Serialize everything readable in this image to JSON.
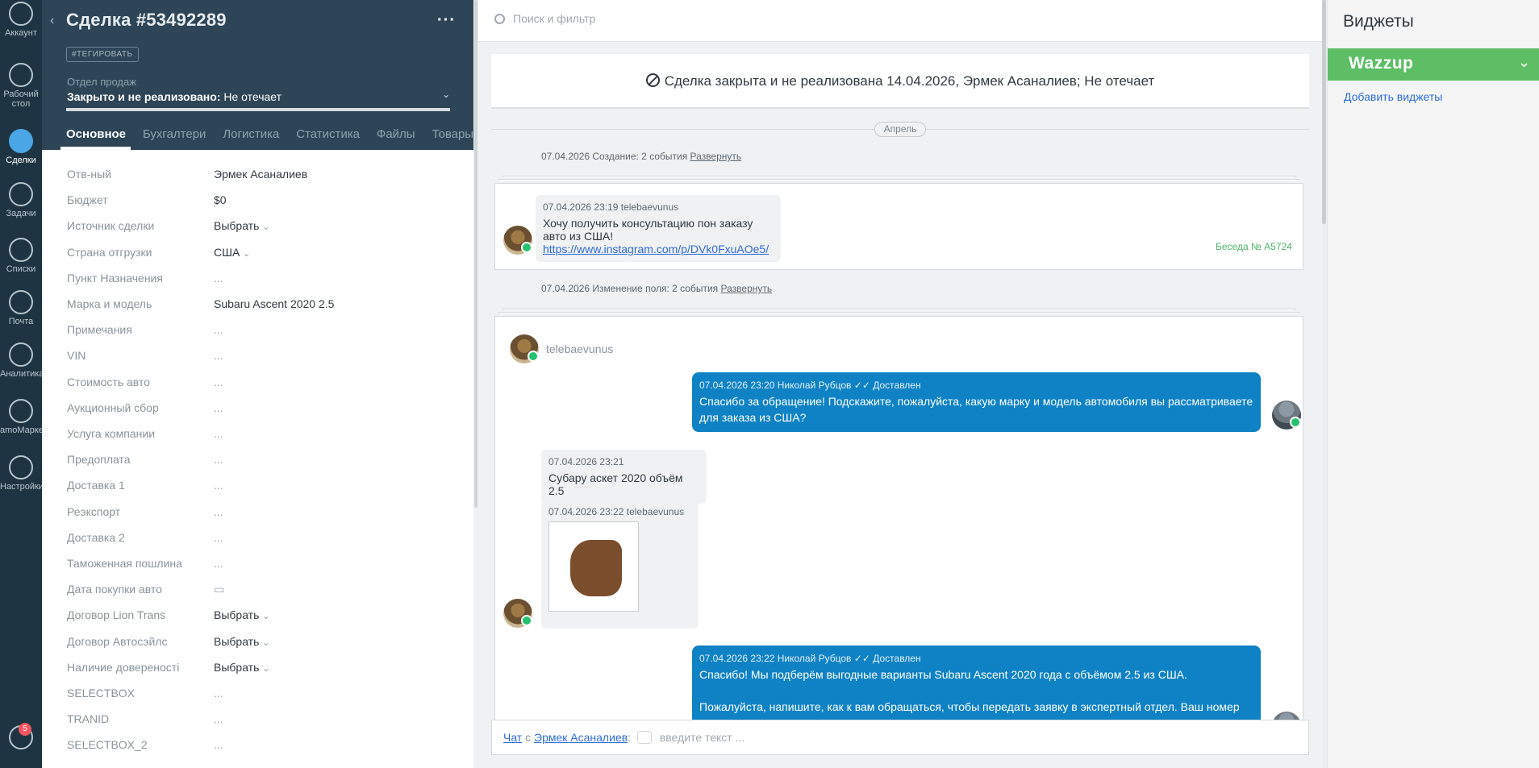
{
  "nav": {
    "items": [
      {
        "label": "Аккаунт",
        "active": false,
        "icon": "account-icon"
      },
      {
        "label": "Рабочий стол",
        "active": false,
        "icon": "dashboard-icon"
      },
      {
        "label": "Сделки",
        "active": true,
        "icon": "deals-icon"
      },
      {
        "label": "Задачи",
        "active": false,
        "icon": "tasks-icon"
      },
      {
        "label": "Списки",
        "active": false,
        "icon": "lists-icon"
      },
      {
        "label": "Почта",
        "active": false,
        "icon": "mail-icon"
      },
      {
        "label": "Аналитика",
        "active": false,
        "icon": "analytics-icon"
      },
      {
        "label": "amoМаркет",
        "active": false,
        "icon": "market-icon"
      },
      {
        "label": "Настройки",
        "active": false,
        "icon": "settings-icon"
      }
    ],
    "notifications_count": "5"
  },
  "card": {
    "title": "Сделка #53492289",
    "tag_button": "#ТЕГИРОВАТЬ",
    "pipeline_label": "Отдел продаж",
    "status_bold": "Закрыто и не реализовано:",
    "status_reason": "Не отечает",
    "tabs": [
      "Основное",
      "Бухгалтери",
      "Логистика",
      "Статистика",
      "Файлы",
      "Товары"
    ],
    "tab_more": "···",
    "fields": [
      {
        "name": "Отв-ный",
        "value": "Эрмек Асаналиев",
        "kind": "text"
      },
      {
        "name": "Бюджет",
        "value": "$0",
        "kind": "text"
      },
      {
        "name": "Источник сделки",
        "value": "Выбрать",
        "kind": "select"
      },
      {
        "name": "Страна отгрузки",
        "value": "США",
        "kind": "select"
      },
      {
        "name": "Пункт Назначения",
        "value": "...",
        "kind": "empty"
      },
      {
        "name": "Марка и модель",
        "value": "Subaru Ascent 2020 2.5",
        "kind": "text"
      },
      {
        "name": "Примечания",
        "value": "...",
        "kind": "empty"
      },
      {
        "name": "VIN",
        "value": "...",
        "kind": "empty"
      },
      {
        "name": "Стоимость авто",
        "value": "...",
        "kind": "empty"
      },
      {
        "name": "Аукционный сбор",
        "value": "...",
        "kind": "empty"
      },
      {
        "name": "Услуга компании",
        "value": "...",
        "kind": "empty"
      },
      {
        "name": "Предоплата",
        "value": "...",
        "kind": "empty"
      },
      {
        "name": "Доставка 1",
        "value": "...",
        "kind": "empty"
      },
      {
        "name": "Реэкспорт",
        "value": "...",
        "kind": "empty"
      },
      {
        "name": "Доставка 2",
        "value": "...",
        "kind": "empty"
      },
      {
        "name": "Таможенная пошлина",
        "value": "...",
        "kind": "empty"
      },
      {
        "name": "Дата покупки авто",
        "value": "▭",
        "kind": "empty"
      },
      {
        "name": "Договор Lion Trans",
        "value": "Выбрать",
        "kind": "select"
      },
      {
        "name": "Договор Автосэйлс",
        "value": "Выбрать",
        "kind": "select"
      },
      {
        "name": "Наличие довереностi",
        "value": "Выбрать",
        "kind": "select"
      },
      {
        "name": "SELECTBOX",
        "value": "...",
        "kind": "empty"
      },
      {
        "name": "TRANID",
        "value": "...",
        "kind": "empty"
      },
      {
        "name": "SELECTBOX_2",
        "value": "...",
        "kind": "empty"
      }
    ]
  },
  "feed": {
    "search_placeholder": "Поиск и фильтр",
    "closed_banner": "Сделка закрыта и не реализована 14.04.2026, Эрмек Асаналиев; Не отечает",
    "month_label": "Апрель",
    "group1": {
      "text": "07.04.2026 Создание: 2 события",
      "link": "Развернуть"
    },
    "msg1": {
      "meta": "07.04.2026 23:19 telebaevunus",
      "text": "Хочу получить консультацию пон заказу авто из США!",
      "link": "https://www.instagram.com/p/DVk0FxuAOe5/",
      "conversation": "Беседа № A5724"
    },
    "group2": {
      "text": "07.04.2026 Изменение поля: 2 события",
      "link": "Развернуть"
    },
    "chat_contact": "telebaevunus",
    "out1": {
      "meta": "07.04.2026 23:20 Николай Рубцов",
      "status": "✓✓ Доставлен",
      "text": "Спасибо за обращение! Подскажите, пожалуйста, какую марку и модель автомобиля вы рассматриваете для заказа из США?"
    },
    "in2": {
      "meta": "07.04.2026 23:21",
      "text": "Субару аскет 2020 объём 2.5"
    },
    "in3": {
      "meta": "07.04.2026 23:22 telebaevunus"
    },
    "out2": {
      "meta": "07.04.2026 23:22 Николай Рубцов",
      "status": "✓✓ Доставлен",
      "text1": "Спасибо! Мы подберём выгодные варианты Subaru Ascent 2020 года с объёмом 2.5 из США.",
      "text2": "Пожалуйста, напишите, как к вам обращаться, чтобы передать заявку в экспертный отдел. Ваш номер"
    },
    "chat_bar": {
      "chat_label": "Чат",
      "with": "с",
      "contact": "Эрмек Асаналиев",
      "colon": ":",
      "placeholder": "введите текст ..."
    }
  },
  "widgets": {
    "title": "Виджеты",
    "wazzup": "Wazzup",
    "add_link": "Добавить виджеты"
  },
  "colors": {
    "nav_bg": "#1e3442",
    "card_head_bg": "#2d4556",
    "outgoing_bubble": "#0f82c5",
    "wazzup_green": "#5dbe65",
    "link_blue": "#2e6cdb"
  }
}
